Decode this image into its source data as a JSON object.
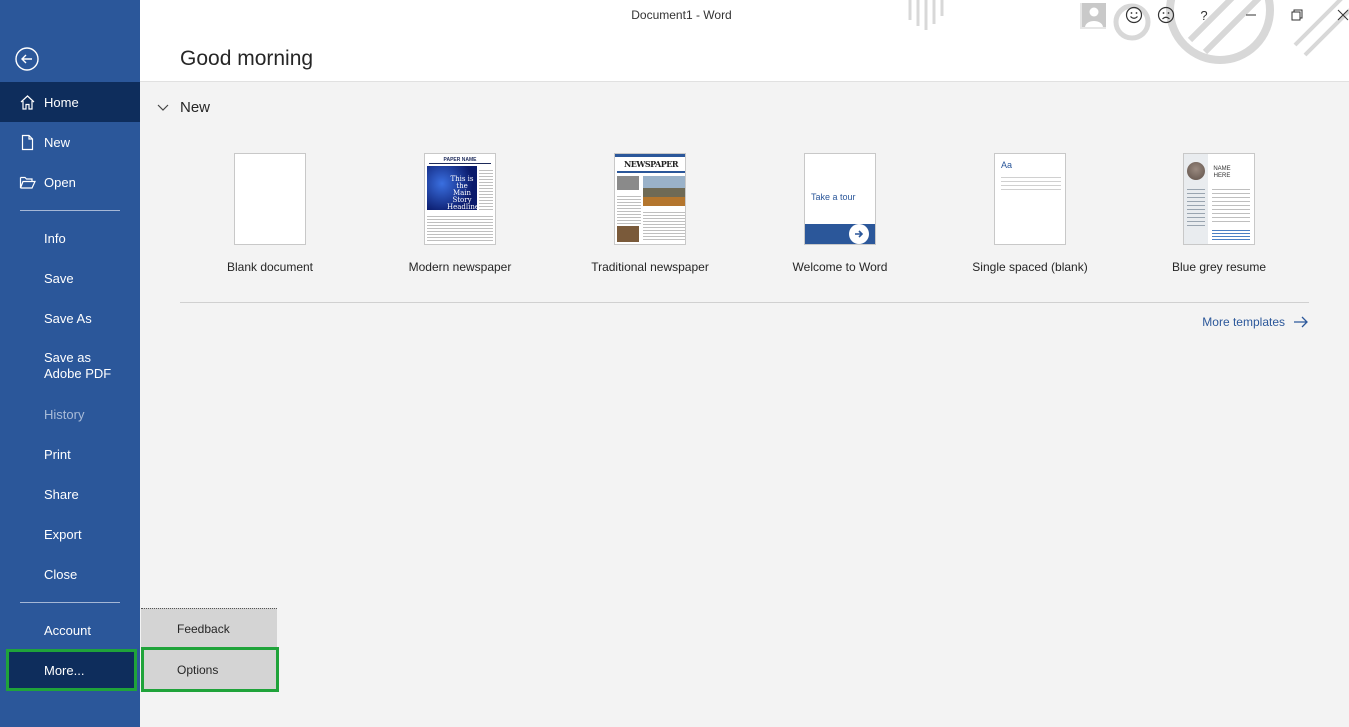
{
  "window": {
    "title": "Document1  -  Word"
  },
  "greeting": "Good morning",
  "sidebar": {
    "items": [
      {
        "label": "Home"
      },
      {
        "label": "New"
      },
      {
        "label": "Open"
      },
      {
        "label": "Info"
      },
      {
        "label": "Save"
      },
      {
        "label": "Save As"
      },
      {
        "label": "Save as Adobe PDF"
      },
      {
        "label": "History"
      },
      {
        "label": "Print"
      },
      {
        "label": "Share"
      },
      {
        "label": "Export"
      },
      {
        "label": "Close"
      },
      {
        "label": "Account"
      },
      {
        "label": "More..."
      }
    ]
  },
  "flyout": {
    "feedback": "Feedback",
    "options": "Options"
  },
  "new_section": {
    "title": "New",
    "templates": [
      {
        "label": "Blank document"
      },
      {
        "label": "Modern newspaper",
        "thumb_text": "This is the Main Story Headline",
        "thumb_banner": "PAPER NAME"
      },
      {
        "label": "Traditional newspaper",
        "thumb_banner": "NEWSPAPER"
      },
      {
        "label": "Welcome to Word",
        "thumb_text": "Take a tour"
      },
      {
        "label": "Single spaced (blank)",
        "thumb_text": "Aa"
      },
      {
        "label": "Blue grey resume",
        "thumb_text": "NAME HERE"
      }
    ],
    "more_templates": "More templates"
  },
  "colors": {
    "sidebar": "#2b579a",
    "active": "#0e2d5c",
    "highlight": "#1fa33a",
    "link": "#2b579a"
  }
}
